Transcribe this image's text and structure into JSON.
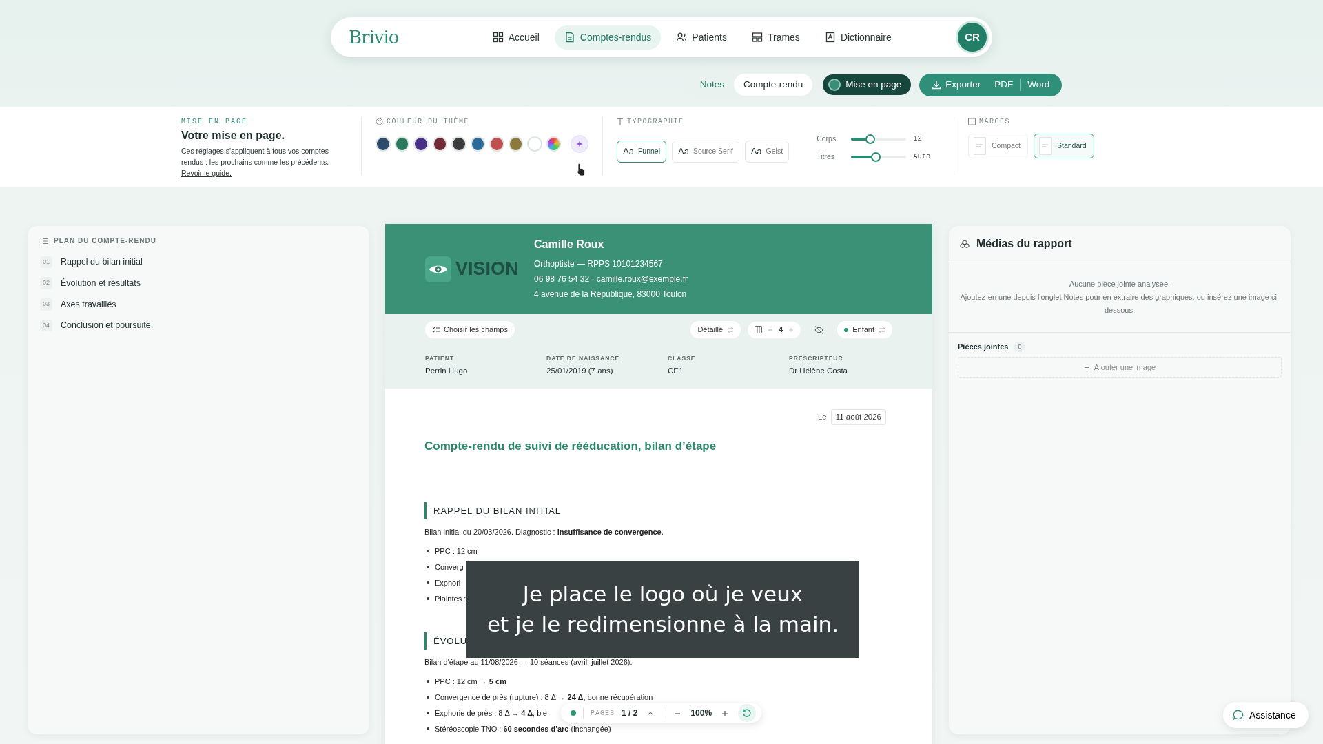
{
  "nav": {
    "logo": "Brivio",
    "avatar": "CR",
    "items": [
      {
        "label": "Accueil",
        "selected": false
      },
      {
        "label": "Comptes-rendus",
        "selected": true
      },
      {
        "label": "Patients",
        "selected": false
      },
      {
        "label": "Trames",
        "selected": false
      },
      {
        "label": "Dictionnaire",
        "selected": false
      }
    ]
  },
  "view_tabs": [
    {
      "label": "Notes",
      "selected": false
    },
    {
      "label": "Compte-rendu",
      "selected": true
    }
  ],
  "layout_toggle": {
    "label": "Mise en page",
    "on": true
  },
  "export": {
    "label": "Exporter",
    "formats": [
      "PDF",
      "Word"
    ]
  },
  "settings": {
    "layout": {
      "eyebrow": "MISE EN PAGE",
      "title": "Votre mise en page.",
      "text": "Ces réglages s'appliquent à tous vos comptes-rendus : les prochains comme les précédents.",
      "link": "Revoir le guide."
    },
    "theme": {
      "heading": "COULEUR DU THÈME",
      "swatches": [
        {
          "kind": "swatch",
          "color": "#2e4a6c"
        },
        {
          "kind": "swatch",
          "color": "#2a7a5e"
        },
        {
          "kind": "swatch",
          "color": "#4a2f86"
        },
        {
          "kind": "swatch",
          "color": "#722a36"
        },
        {
          "kind": "swatch",
          "color": "#3b3b3d"
        },
        {
          "kind": "swatch",
          "color": "#2a6a98"
        },
        {
          "kind": "swatch",
          "color": "#c0504f"
        },
        {
          "kind": "swatch",
          "color": "#8b7a3b"
        },
        {
          "kind": "swatch",
          "color": "#ffffff"
        },
        {
          "kind": "spectrum"
        },
        {
          "kind": "magic"
        }
      ]
    },
    "typography": {
      "heading": "TYPOGRAPHIE",
      "fonts": [
        {
          "sample": "Aa",
          "name": "Funnel",
          "selected": true
        },
        {
          "sample": "Aa",
          "name": "Source Serif",
          "selected": false
        },
        {
          "sample": "Aa",
          "name": "Geist",
          "selected": false
        }
      ],
      "sliders": [
        {
          "label": "Corps",
          "level": 0.35,
          "reading": "12"
        },
        {
          "label": "Titres",
          "level": 0.45,
          "reading": "Auto"
        }
      ]
    },
    "margins": {
      "heading": "MARGES",
      "options": [
        {
          "label": "Compact",
          "selected": false
        },
        {
          "label": "Standard",
          "selected": true
        }
      ]
    }
  },
  "outline": {
    "heading": "PLAN DU COMPTE-RENDU",
    "items": [
      {
        "number": "01",
        "label": "Rappel du bilan initial"
      },
      {
        "number": "02",
        "label": "Évolution et résultats"
      },
      {
        "number": "03",
        "label": "Axes travaillés"
      },
      {
        "number": "04",
        "label": "Conclusion et poursuite"
      }
    ]
  },
  "document": {
    "header": {
      "logo": "VISION",
      "name": "Camille Roux",
      "lines": [
        "Orthoptiste — RPPS 10101234567",
        "06 98 76 54 32 · camille.roux@exemple.fr",
        "4 avenue de la République, 83000 Toulon"
      ]
    },
    "toolbar": {
      "fields_button": "Choisir les champs",
      "detail": "Détaillé",
      "columns": "4",
      "audience": "Enfant"
    },
    "info": [
      {
        "label": "PATIENT",
        "value": "Perrin Hugo"
      },
      {
        "label": "DATE DE NAISSANCE",
        "value": "25/01/2019 (7 ans)"
      },
      {
        "label": "CLASSE",
        "value": "CE1"
      },
      {
        "label": "PRESCRIPTEUR",
        "value": "Dr Hélène Costa"
      }
    ],
    "date_label": "Le",
    "date": "11 août 2026",
    "title": "Compte-rendu de suivi de rééducation, bilan d’étape",
    "sections": [
      {
        "heading": "RAPPEL DU BILAN INITIAL",
        "intro": "Bilan initial du 20/03/2026. Diagnostic : **insuffisance de convergence**.",
        "items": [
          "PPC : 12 cm",
          "Converg",
          "Exphori",
          "Plaintes :"
        ]
      },
      {
        "heading": "ÉVOLU",
        "intro": "Bilan d'étape au 11/08/2026 — 10 séances (avril–juillet 2026).",
        "items": [
          "PPC : 12 cm → **5 cm**",
          "Convergence de près (rupture) : 8 Δ → **24 Δ**, bonne récupération",
          "Exphorie de près : 8 Δ → **4 Δ**, bie",
          "Stéréoscopie TNO : **60 secondes d'arc** (inchangée)"
        ]
      }
    ]
  },
  "caption": [
    "Je place le logo où je veux",
    "et je le redimensionne à la main."
  ],
  "pager": {
    "label": "PAGES",
    "value": "1 / 2",
    "zoom": "100%"
  },
  "media": {
    "title": "Médias du rapport",
    "empty_title": "Aucune pièce jointe analysée.",
    "empty_text": "Ajoutez-en une depuis l'onglet Notes pour en extraire des graphiques, ou insérez une image ci-dessous.",
    "attachments_label": "Pièces jointes",
    "attachments_count": "0",
    "add_button": "Ajouter une image"
  },
  "assistance": "Assistance"
}
